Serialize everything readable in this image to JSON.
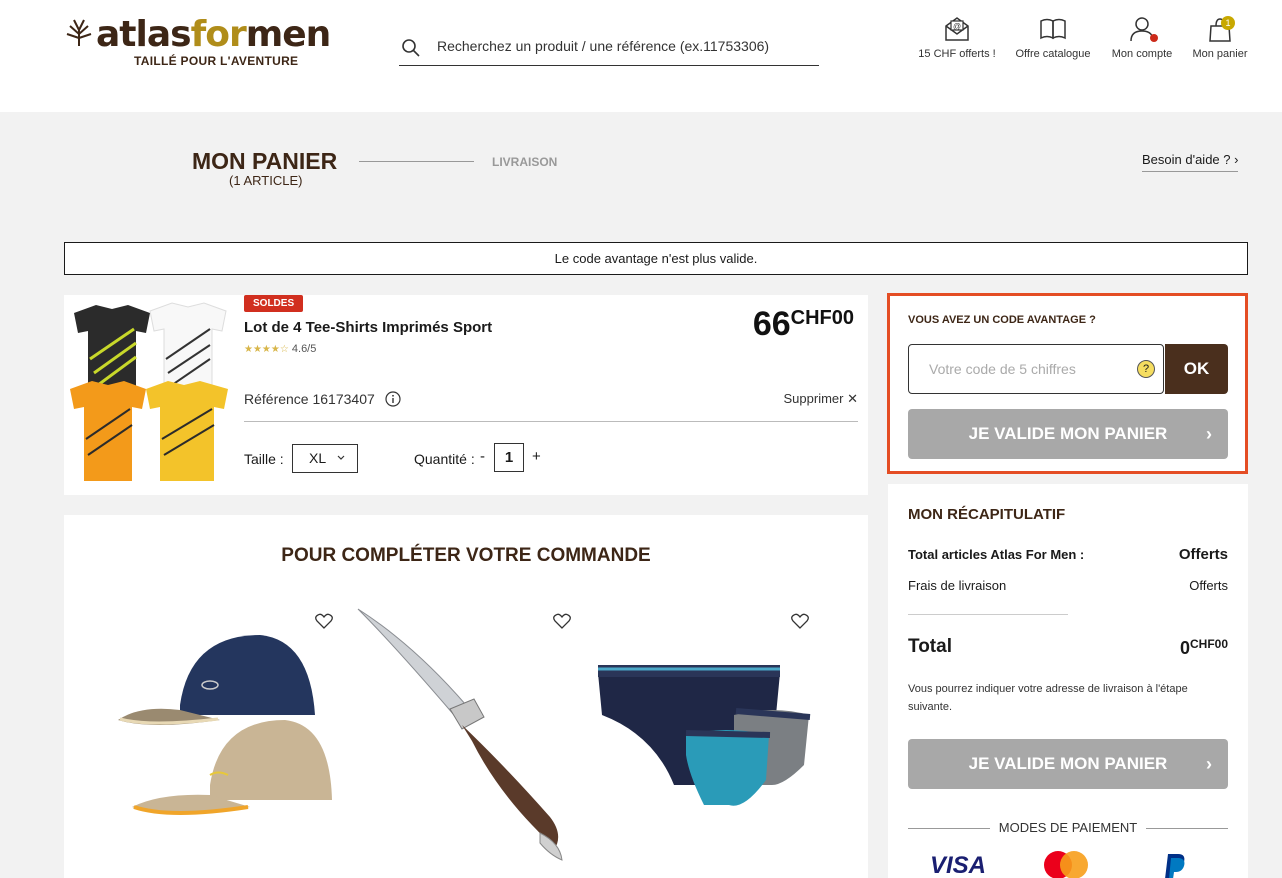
{
  "header": {
    "logo_name": "atlas",
    "logo_for": "for",
    "logo_men": "men",
    "logo_tagline": "TAILLÉ POUR L'AVENTURE",
    "search_placeholder": "Recherchez un produit / une référence (ex.11753306)",
    "nav": [
      {
        "label": "15 CHF offerts !",
        "icon": "gift-mail-icon"
      },
      {
        "label": "Offre catalogue",
        "icon": "catalog-book-icon"
      },
      {
        "label": "Mon compte",
        "icon": "account-icon"
      },
      {
        "label": "Mon panier",
        "icon": "cart-bag-icon"
      }
    ],
    "cart_count": "1"
  },
  "steps": {
    "current": "MON PANIER",
    "current_sub": "(1 ARTICLE)",
    "next": "LIVRAISON",
    "help": "Besoin d'aide ?"
  },
  "alert": "Le code avantage n'est plus valide.",
  "product": {
    "badge": "SOLDES",
    "name": "Lot de 4 Tee-Shirts Imprimés Sport",
    "stars": "★★★★☆",
    "rating": 4.6,
    "rating_text": "4.6/5",
    "price_int": "66",
    "price_dec": "CHF00",
    "reference": "Référence 16173407",
    "delete": "Supprimer ✕",
    "size_label": "Taille :",
    "size_value": "XL",
    "qty_label": "Quantité :",
    "qty_minus": "-",
    "qty_value": "1",
    "qty_plus": "+",
    "colors": [
      "#2b2b2b",
      "#ffffff",
      "#f39a1a",
      "#f3c32a"
    ]
  },
  "suggestions": {
    "title": "POUR COMPLÉTER VOTRE COMMANDE",
    "items": [
      {
        "name": "caps",
        "icon": "heart-icon"
      },
      {
        "name": "knife",
        "icon": "heart-icon"
      },
      {
        "name": "briefs",
        "icon": "heart-icon"
      }
    ]
  },
  "coupon": {
    "title": "VOUS AVEZ UN CODE AVANTAGE ?",
    "placeholder": "Votre code de 5 chiffres",
    "help": "?",
    "ok": "OK",
    "validate": "JE VALIDE MON PANIER",
    "chevron": "›"
  },
  "recap": {
    "title": "MON RÉCAPITULATIF",
    "items_label": "Total articles Atlas For Men :",
    "items_value": "Offerts",
    "shipping_label": "Frais de livraison",
    "shipping_value": "Offerts",
    "total_label": "Total",
    "total_int": "0",
    "total_dec": "CHF00",
    "note": "Vous pourrez indiquer votre adresse de livraison à l'étape suivante.",
    "validate": "JE VALIDE MON PANIER",
    "chevron": "›",
    "payment_title": "MODES DE PAIEMENT",
    "payment_methods": [
      "VISA",
      "Mastercard",
      "PayPal"
    ]
  },
  "colors": {
    "brand_brown": "#3d2616",
    "brand_gold": "#b08d1a",
    "highlight": "#e44d24",
    "sale_red": "#d12f1f",
    "button_disabled": "#a8a8a8"
  }
}
